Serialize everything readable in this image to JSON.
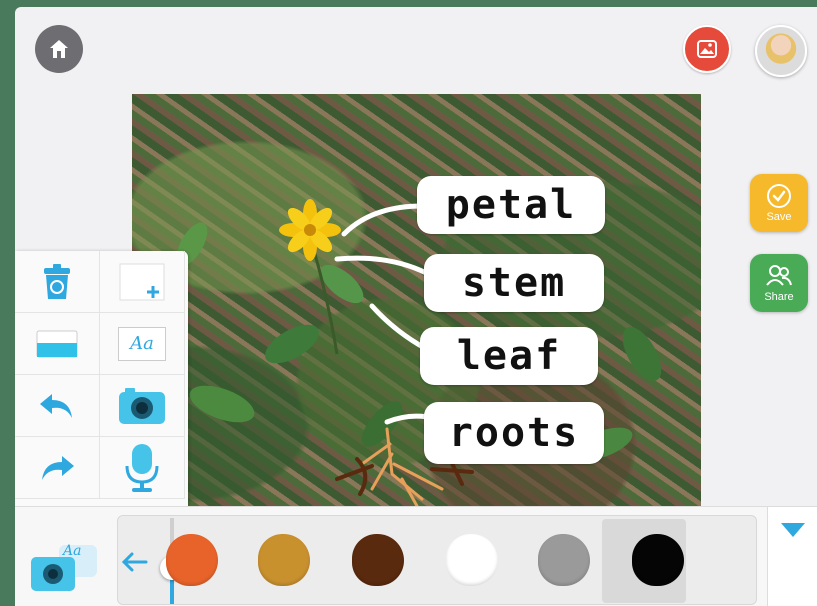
{
  "app": {
    "accent": "#2fa7df",
    "frame_background": "#f1f1f3",
    "outer_background": "#4a7a5c"
  },
  "topbar": {
    "home_icon": "home-icon",
    "gallery_icon": "image-icon",
    "avatar_icon": "user-avatar"
  },
  "canvas": {
    "labels": [
      {
        "text": "petal"
      },
      {
        "text": "stem"
      },
      {
        "text": "leaf"
      },
      {
        "text": "roots"
      }
    ]
  },
  "sidebar": {
    "save_label": "Save",
    "share_label": "Share",
    "save_color": "#f5b92b",
    "share_color": "#4aab57"
  },
  "tools": [
    {
      "name": "trash",
      "icon": "trash-icon"
    },
    {
      "name": "add-page",
      "icon": "add-page-icon"
    },
    {
      "name": "fill",
      "icon": "fill-icon"
    },
    {
      "name": "text",
      "icon": "text-icon",
      "label": "Aa"
    },
    {
      "name": "undo",
      "icon": "undo-icon"
    },
    {
      "name": "camera",
      "icon": "camera-icon"
    },
    {
      "name": "redo",
      "icon": "redo-icon"
    },
    {
      "name": "microphone",
      "icon": "microphone-icon"
    }
  ],
  "bottombar": {
    "logo_label": "Aa",
    "colors": [
      {
        "name": "orange",
        "hex": "#e8632a"
      },
      {
        "name": "tan",
        "hex": "#c9902e"
      },
      {
        "name": "brown",
        "hex": "#5a2a0e"
      },
      {
        "name": "white",
        "hex": "#ffffff"
      },
      {
        "name": "gray",
        "hex": "#9a9a9a"
      },
      {
        "name": "black",
        "hex": "#050505",
        "selected": true
      }
    ],
    "brush_size_fraction": 0.5
  }
}
